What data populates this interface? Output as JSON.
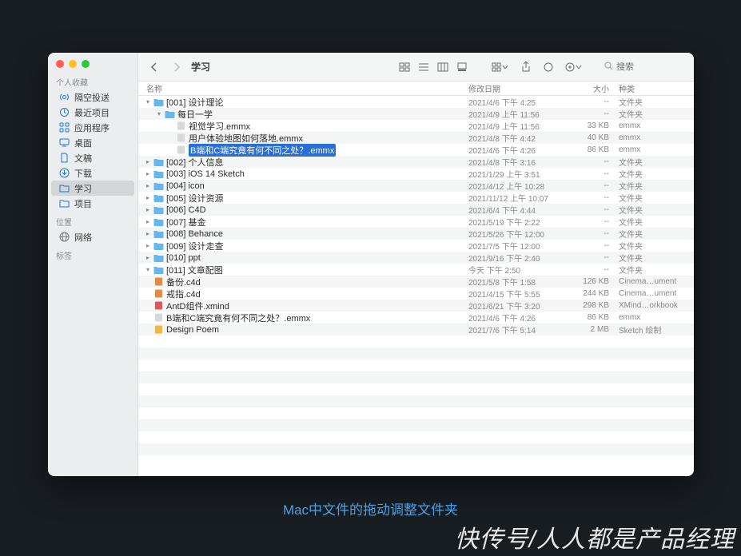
{
  "window_title": "学习",
  "sidebar": {
    "sections": [
      {
        "label": "个人收藏",
        "items": [
          {
            "icon": "airdrop",
            "label": "隔空投送"
          },
          {
            "icon": "clock",
            "label": "最近项目"
          },
          {
            "icon": "apps",
            "label": "应用程序"
          },
          {
            "icon": "desktop",
            "label": "桌面"
          },
          {
            "icon": "doc",
            "label": "文稿"
          },
          {
            "icon": "download",
            "label": "下载"
          },
          {
            "icon": "folder",
            "label": "学习",
            "selected": true
          },
          {
            "icon": "folder",
            "label": "项目"
          }
        ]
      },
      {
        "label": "位置",
        "items": [
          {
            "icon": "network",
            "label": "网络",
            "gray": true
          }
        ]
      },
      {
        "label": "标签",
        "items": []
      }
    ]
  },
  "toolbar": {
    "search_placeholder": "搜索"
  },
  "columns": {
    "name": "名称",
    "date": "修改日期",
    "size": "大小",
    "kind": "种类"
  },
  "rows": [
    {
      "depth": 0,
      "disc": "open",
      "icon": "folder",
      "name": "[001] 设计理论",
      "date": "2021/4/6 下午 4:25",
      "size": "--",
      "kind": "文件夹"
    },
    {
      "depth": 1,
      "disc": "open",
      "icon": "folder",
      "name": "每日一学",
      "date": "2021/4/9 上午 11:56",
      "size": "--",
      "kind": "文件夹"
    },
    {
      "depth": 2,
      "disc": "",
      "icon": "file",
      "name": "视觉学习.emmx",
      "date": "2021/4/9 上午 11:56",
      "size": "33 KB",
      "kind": "emmx"
    },
    {
      "depth": 2,
      "disc": "",
      "icon": "file",
      "name": "用户体验地图如何落地.emmx",
      "date": "2021/4/8 下午 4:42",
      "size": "40 KB",
      "kind": "emmx"
    },
    {
      "depth": 2,
      "disc": "",
      "icon": "file",
      "name": "B端和C端究竟有何不同之处？.emmx",
      "editing": true,
      "date": "2021/4/6 下午 4:26",
      "size": "86 KB",
      "kind": "emmx"
    },
    {
      "depth": 0,
      "disc": "closed",
      "icon": "folder",
      "name": "[002] 个人信息",
      "date": "2021/4/8 下午 3:16",
      "size": "--",
      "kind": "文件夹"
    },
    {
      "depth": 0,
      "disc": "closed",
      "icon": "folder",
      "name": "[003] iOS 14 Sketch",
      "date": "2021/1/29 上午 3:51",
      "size": "--",
      "kind": "文件夹"
    },
    {
      "depth": 0,
      "disc": "closed",
      "icon": "folder",
      "name": "[004] icon",
      "date": "2021/4/12 上午 10:28",
      "size": "--",
      "kind": "文件夹"
    },
    {
      "depth": 0,
      "disc": "closed",
      "icon": "folder",
      "name": "[005] 设计资源",
      "date": "2021/11/12 上午 10:07",
      "size": "--",
      "kind": "文件夹"
    },
    {
      "depth": 0,
      "disc": "closed",
      "icon": "folder",
      "name": "[006] C4D",
      "date": "2021/6/4 下午 4:44",
      "size": "--",
      "kind": "文件夹"
    },
    {
      "depth": 0,
      "disc": "closed",
      "icon": "folder",
      "name": "[007] 基金",
      "date": "2021/5/19 下午 2:22",
      "size": "--",
      "kind": "文件夹"
    },
    {
      "depth": 0,
      "disc": "closed",
      "icon": "folder",
      "name": "[008] Behance",
      "date": "2021/5/26 下午 12:00",
      "size": "--",
      "kind": "文件夹"
    },
    {
      "depth": 0,
      "disc": "closed",
      "icon": "folder",
      "name": "[009] 设计走查",
      "date": "2021/7/5 下午 12:00",
      "size": "--",
      "kind": "文件夹"
    },
    {
      "depth": 0,
      "disc": "closed",
      "icon": "folder",
      "name": "[010] ppt",
      "date": "2021/9/16 下午 2:40",
      "size": "--",
      "kind": "文件夹"
    },
    {
      "depth": 0,
      "disc": "open",
      "icon": "folder",
      "name": "[011] 文章配图",
      "date": "今天 下午 2:50",
      "size": "--",
      "kind": "文件夹"
    },
    {
      "depth": 0,
      "disc": "",
      "icon": "file-c4d",
      "name": "备份.c4d",
      "date": "2021/5/8 下午 1:58",
      "size": "126 KB",
      "kind": "Cinema…ument"
    },
    {
      "depth": 0,
      "disc": "",
      "icon": "file-c4d",
      "name": "戒指.c4d",
      "date": "2021/4/15 下午 5:55",
      "size": "244 KB",
      "kind": "Cinema…ument"
    },
    {
      "depth": 0,
      "disc": "",
      "icon": "file-xm",
      "name": "AntD组件.xmind",
      "date": "2021/6/21 下午 3:20",
      "size": "298 KB",
      "kind": "XMind…orkbook"
    },
    {
      "depth": 0,
      "disc": "",
      "icon": "file",
      "name": "B端和C端究竟有何不同之处？.emmx",
      "date": "2021/4/6 下午 4:26",
      "size": "86 KB",
      "kind": "emmx"
    },
    {
      "depth": 0,
      "disc": "",
      "icon": "file-sk",
      "name": "Design Poem",
      "date": "2021/7/6 下午 5:14",
      "size": "2 MB",
      "kind": "Sketch 绘制"
    }
  ],
  "caption": "Mac中文件的拖动调整文件夹",
  "stamp": "快传号/人人都是产品经理"
}
